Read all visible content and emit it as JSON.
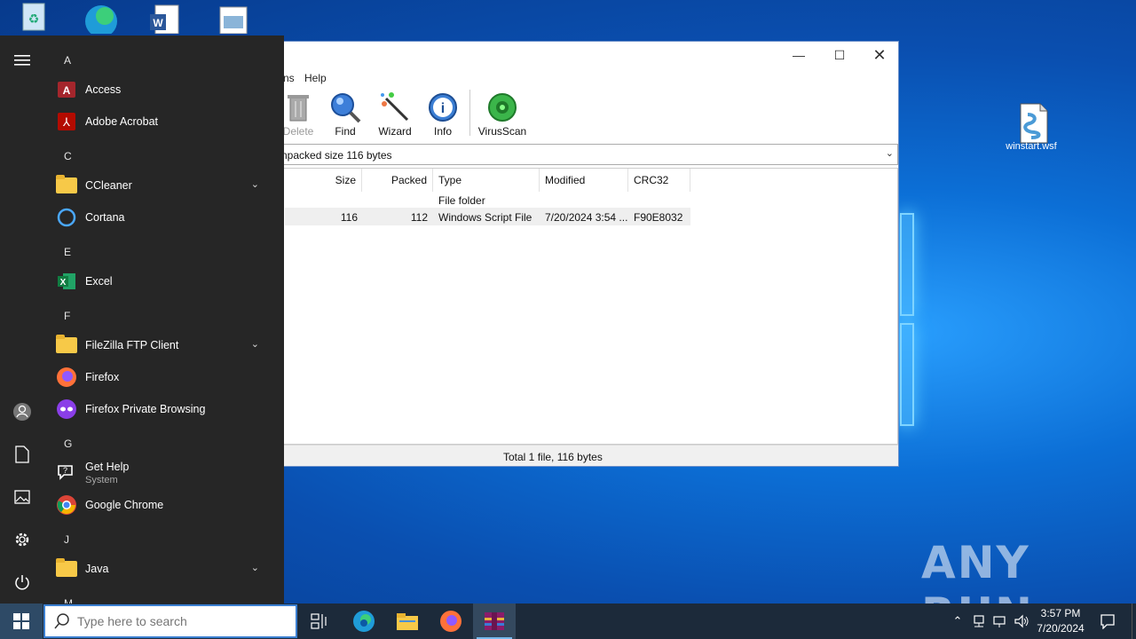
{
  "desktop": {
    "file_icon_label": "winstart.wsf",
    "watermark": "ANY RUN"
  },
  "winrar": {
    "menu_visible": [
      "ns",
      "Help"
    ],
    "toolbar": {
      "delete": "Delete",
      "find": "Find",
      "wizard": "Wizard",
      "info": "Info",
      "virusscan": "VirusScan"
    },
    "address_text": "npacked size 116 bytes",
    "columns": [
      "Size",
      "Packed",
      "Type",
      "Modified",
      "CRC32"
    ],
    "rows": [
      {
        "size": "",
        "packed": "",
        "type": "File folder",
        "modified": "",
        "crc": ""
      },
      {
        "size": "116",
        "packed": "112",
        "type": "Windows Script File",
        "modified": "7/20/2024 3:54 ...",
        "crc": "F90E8032"
      }
    ],
    "status": "Total 1 file, 116 bytes"
  },
  "startmenu": {
    "groups": [
      {
        "letter": "A",
        "apps": [
          {
            "name": "Access",
            "icon": "access-icon"
          },
          {
            "name": "Adobe Acrobat",
            "icon": "acrobat-icon"
          }
        ]
      },
      {
        "letter": "C",
        "apps": [
          {
            "name": "CCleaner",
            "icon": "folder-icon",
            "expand": true
          },
          {
            "name": "Cortana",
            "icon": "cortana-icon"
          }
        ]
      },
      {
        "letter": "E",
        "apps": [
          {
            "name": "Excel",
            "icon": "excel-icon"
          }
        ]
      },
      {
        "letter": "F",
        "apps": [
          {
            "name": "FileZilla FTP Client",
            "icon": "folder-icon",
            "expand": true
          },
          {
            "name": "Firefox",
            "icon": "firefox-icon"
          },
          {
            "name": "Firefox Private Browsing",
            "icon": "firefox-private-icon"
          }
        ]
      },
      {
        "letter": "G",
        "apps": [
          {
            "name": "Get Help",
            "sub": "System",
            "icon": "get-help-icon"
          },
          {
            "name": "Google Chrome",
            "icon": "chrome-icon"
          }
        ]
      },
      {
        "letter": "J",
        "apps": [
          {
            "name": "Java",
            "icon": "folder-icon",
            "expand": true
          }
        ]
      },
      {
        "letter": "M",
        "apps": []
      }
    ]
  },
  "taskbar": {
    "search_placeholder": "Type here to search",
    "time": "3:57 PM",
    "date": "7/20/2024"
  }
}
